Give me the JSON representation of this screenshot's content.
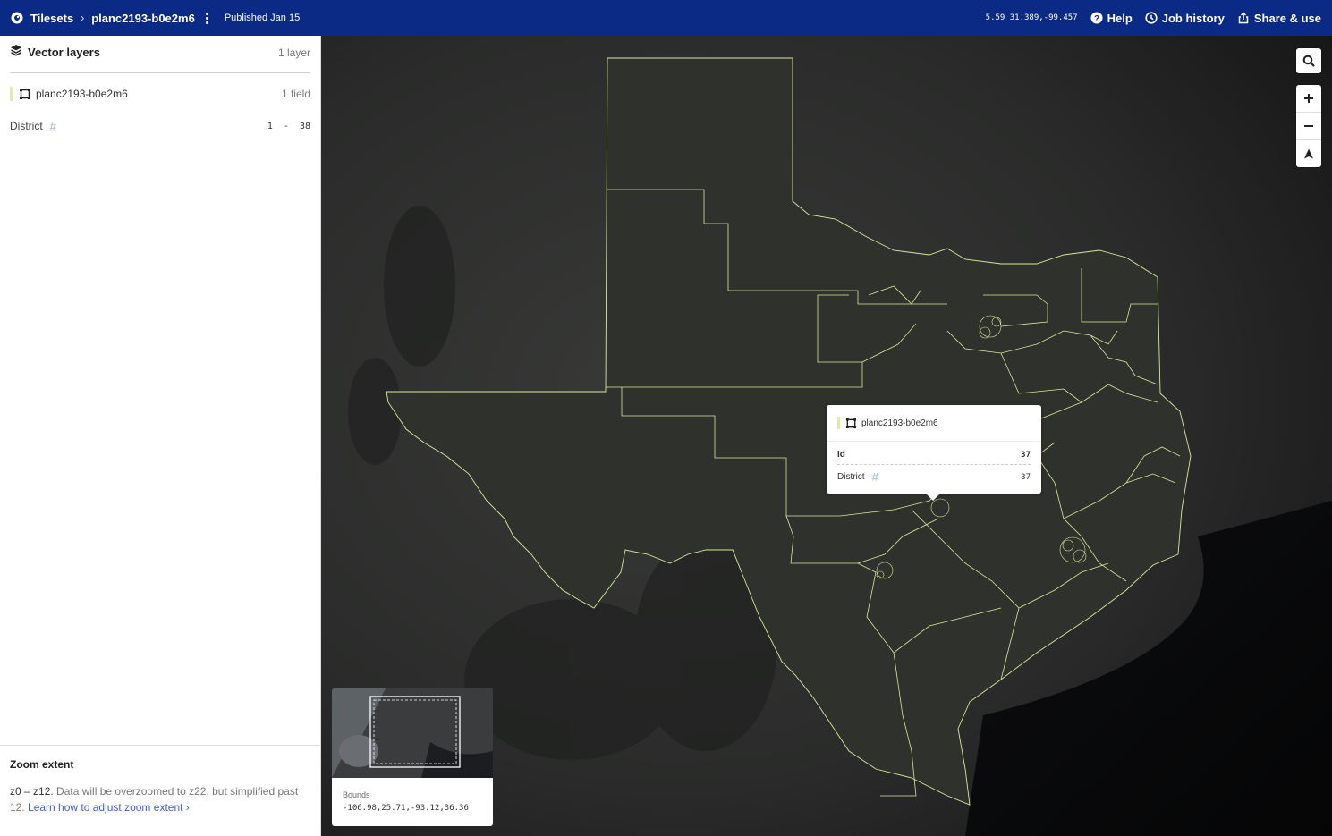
{
  "topbar": {
    "tilesets_label": "Tilesets",
    "tileset_name": "planc2193-b0e2m6",
    "published": "Published Jan 15",
    "zoom": "5.59",
    "coords": "31.389,-99.457",
    "help": "Help",
    "job_history": "Job history",
    "share": "Share & use"
  },
  "sidebar": {
    "header_title": "Vector layers",
    "header_count": "1 layer",
    "layer_name": "planc2193-b0e2m6",
    "layer_fields": "1 field",
    "field_name": "District",
    "field_range": "1  -  38",
    "zoom_title": "Zoom extent",
    "zoom_range": "z0 – z12.",
    "zoom_text": " Data will be overzoomed to z22, but simplified past 12. ",
    "zoom_link": "Learn how to adjust zoom extent"
  },
  "popup": {
    "layer": "planc2193-b0e2m6",
    "id_label": "Id",
    "id_value": "37",
    "district_label": "District",
    "district_value": "37"
  },
  "minimap": {
    "label": "Bounds",
    "value": "-106.98,25.71,-93.12,36.36"
  },
  "colors": {
    "topbar": "#0b2a86",
    "accent": "#d7f0a2",
    "link": "#3d5dd8",
    "district_line": "#d9e8a0"
  }
}
